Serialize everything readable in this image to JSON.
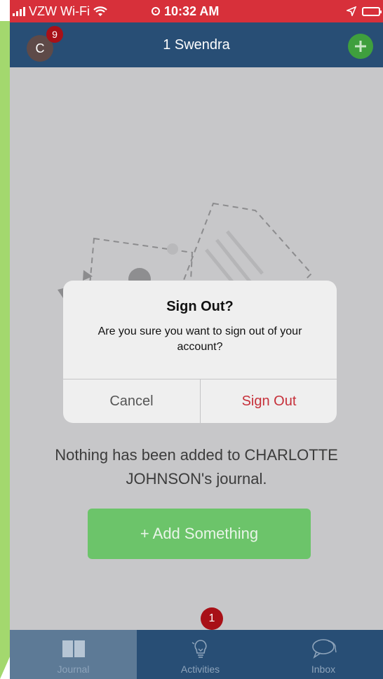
{
  "status_bar": {
    "carrier": "VZW Wi-Fi",
    "time": "10:32 AM"
  },
  "nav": {
    "avatar_initial": "C",
    "avatar_badge": "9",
    "title": "1 Swendra"
  },
  "alert": {
    "title": "Sign Out?",
    "message": "Are you sure you want to sign out of your account?",
    "cancel_label": "Cancel",
    "confirm_label": "Sign Out"
  },
  "empty_state": {
    "message": "Nothing has been added to CHARLOTTE JOHNSON's journal.",
    "button_label": "+ Add Something"
  },
  "tabs": [
    {
      "label": "Journal"
    },
    {
      "label": "Activities",
      "badge": "1"
    },
    {
      "label": "Inbox"
    }
  ],
  "colors": {
    "status_bar": "#d7303a",
    "nav_bar": "#284e75",
    "add_button": "#3f9f3d",
    "badge": "#a81017",
    "destructive": "#c6303a",
    "primary_action": "#6cc46a"
  },
  "icons": {
    "wifi": "wifi-icon",
    "location": "location-arrow-icon",
    "battery": "battery-icon",
    "add": "plus-icon",
    "journal": "book-icon",
    "activities": "lightbulb-icon",
    "inbox": "chat-bubbles-icon"
  }
}
